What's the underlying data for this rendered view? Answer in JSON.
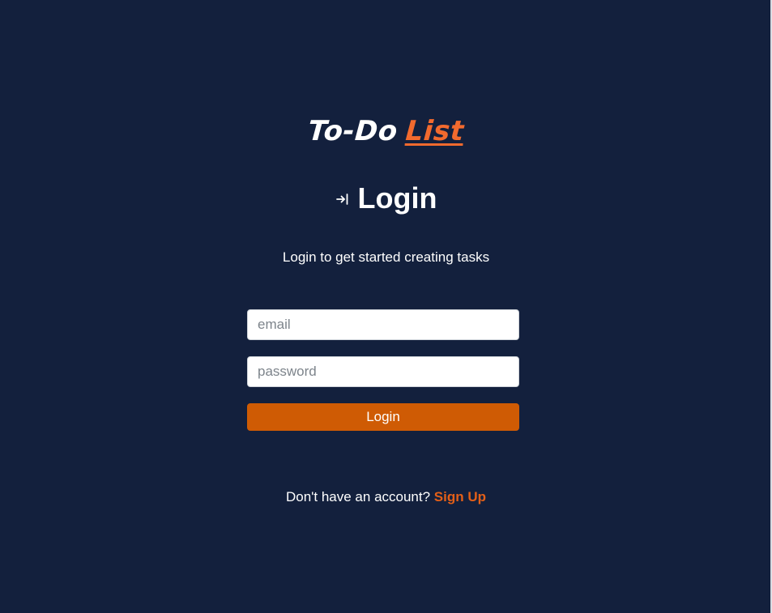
{
  "logo": {
    "part1": "To-Do",
    "part2": "List",
    "accent_color": "#f26a2e"
  },
  "heading": {
    "icon": "login-arrow-icon",
    "title": "Login"
  },
  "subtitle": "Login to get started creating tasks",
  "form": {
    "email_placeholder": "email",
    "email_value": "",
    "password_placeholder": "password",
    "password_value": "",
    "submit_label": "Login",
    "button_color": "#cf5b04"
  },
  "footer": {
    "prompt": "Don't have an account?",
    "link_label": "Sign Up",
    "link_color": "#e35f18"
  },
  "colors": {
    "background": "#13203d",
    "text": "#ffffff"
  }
}
